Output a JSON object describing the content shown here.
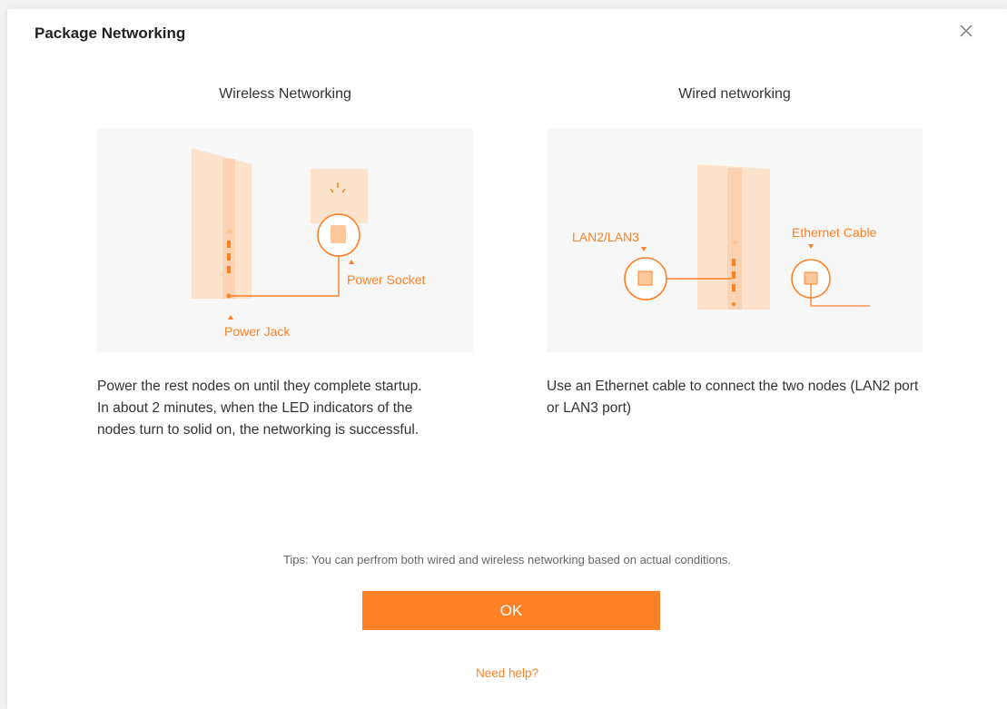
{
  "dialog": {
    "title": "Package Networking",
    "close_icon": "close-icon"
  },
  "wireless": {
    "title": "Wireless Networking",
    "labels": {
      "power_socket": "Power Socket",
      "power_jack": "Power Jack"
    },
    "description": [
      "Power the rest nodes on until they complete startup.",
      "In about 2 minutes, when the LED indicators of the nodes turn to solid on, the networking is successful."
    ]
  },
  "wired": {
    "title": "Wired networking",
    "labels": {
      "lan": "LAN2/LAN3",
      "ethernet_cable": "Ethernet Cable"
    },
    "description": [
      "Use an Ethernet cable to connect the two nodes (LAN2 port or LAN3 port)"
    ]
  },
  "tips": "Tips: You can perfrom both wired and wireless networking based on actual conditions.",
  "ok_label": "OK",
  "help_link": "Need help?",
  "colors": {
    "accent": "#ff8025",
    "node_fill": "#fde3cc",
    "node_shade": "#fbd3b2"
  }
}
